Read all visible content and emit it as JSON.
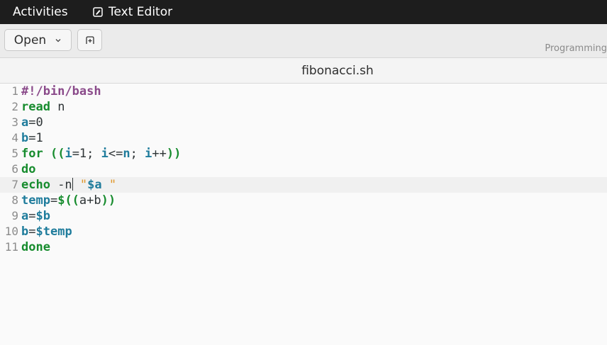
{
  "topbar": {
    "activities": "Activities",
    "app_name": "Text Editor"
  },
  "header": {
    "open_label": "Open",
    "language": "Programming"
  },
  "tab": {
    "filename": "fibonacci.sh"
  },
  "editor": {
    "current_line": 7,
    "lines": [
      {
        "num": "1",
        "segments": [
          {
            "t": "#!/bin/bash",
            "c": "sh"
          }
        ]
      },
      {
        "num": "2",
        "segments": [
          {
            "t": "read",
            "c": "kw"
          },
          {
            "t": " n",
            "c": ""
          }
        ]
      },
      {
        "num": "3",
        "segments": [
          {
            "t": "a",
            "c": "var"
          },
          {
            "t": "=0",
            "c": ""
          }
        ]
      },
      {
        "num": "4",
        "segments": [
          {
            "t": "b",
            "c": "var"
          },
          {
            "t": "=1",
            "c": ""
          }
        ]
      },
      {
        "num": "5",
        "segments": [
          {
            "t": "for",
            "c": "kw"
          },
          {
            "t": " ((",
            "c": "kw"
          },
          {
            "t": "i",
            "c": "var"
          },
          {
            "t": "=1; ",
            "c": ""
          },
          {
            "t": "i",
            "c": "var"
          },
          {
            "t": "<=",
            "c": ""
          },
          {
            "t": "n",
            "c": "var"
          },
          {
            "t": "; ",
            "c": ""
          },
          {
            "t": "i",
            "c": "var"
          },
          {
            "t": "++",
            "c": ""
          },
          {
            "t": "))",
            "c": "kw"
          }
        ]
      },
      {
        "num": "6",
        "segments": [
          {
            "t": "do",
            "c": "kw"
          }
        ]
      },
      {
        "num": "7",
        "segments": [
          {
            "t": "echo",
            "c": "kw"
          },
          {
            "t": " -n",
            "c": ""
          },
          {
            "t": "",
            "c": "cursor"
          },
          {
            "t": " \"",
            "c": "str"
          },
          {
            "t": "$a",
            "c": "var"
          },
          {
            "t": " \"",
            "c": "str"
          }
        ]
      },
      {
        "num": "8",
        "segments": [
          {
            "t": "temp",
            "c": "var"
          },
          {
            "t": "=",
            "c": ""
          },
          {
            "t": "$((",
            "c": "kw"
          },
          {
            "t": "a+b",
            "c": ""
          },
          {
            "t": "))",
            "c": "kw"
          }
        ]
      },
      {
        "num": "9",
        "segments": [
          {
            "t": "a",
            "c": "var"
          },
          {
            "t": "=",
            "c": ""
          },
          {
            "t": "$b",
            "c": "var"
          }
        ]
      },
      {
        "num": "10",
        "segments": [
          {
            "t": "b",
            "c": "var"
          },
          {
            "t": "=",
            "c": ""
          },
          {
            "t": "$temp",
            "c": "var"
          }
        ]
      },
      {
        "num": "11",
        "segments": [
          {
            "t": "done",
            "c": "kw"
          }
        ]
      }
    ]
  }
}
